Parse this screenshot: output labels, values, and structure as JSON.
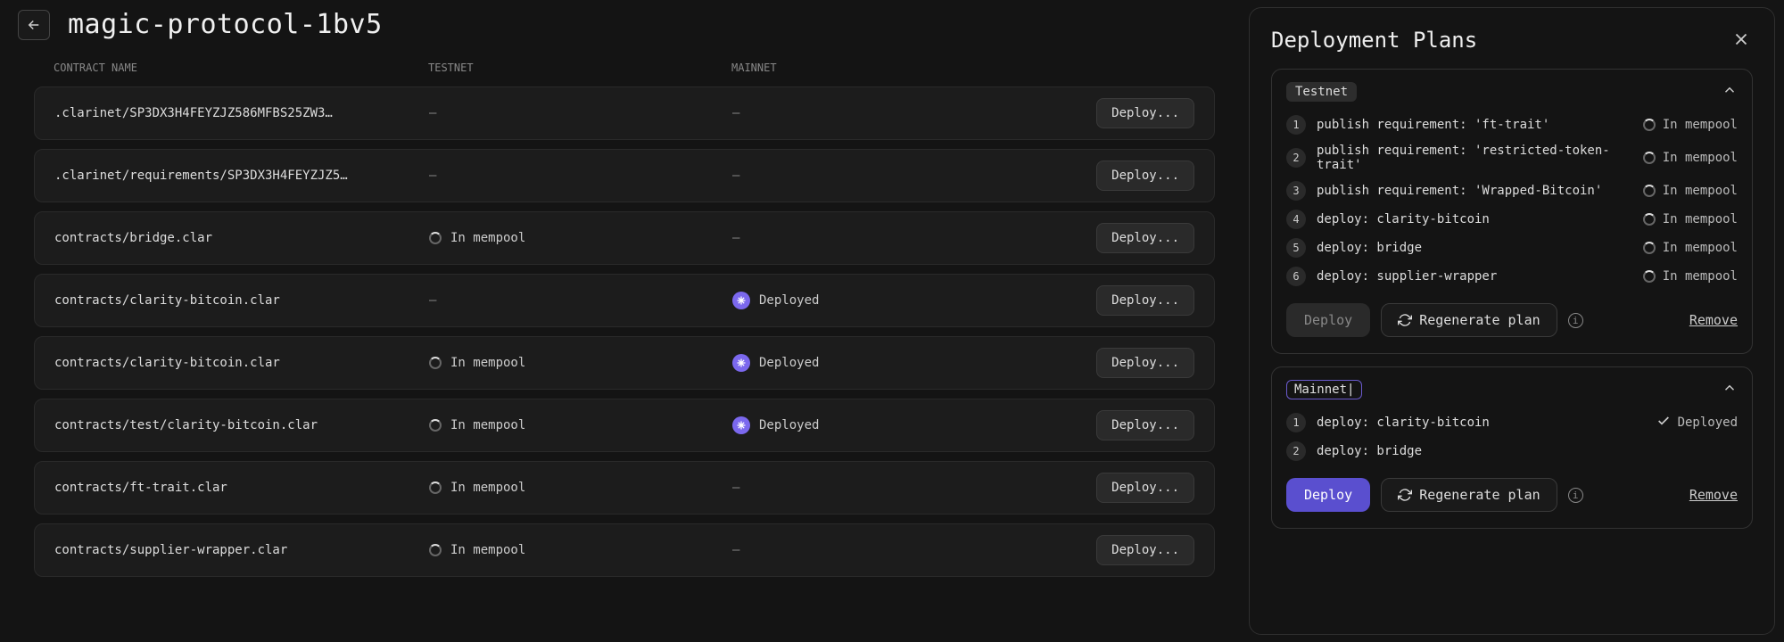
{
  "header": {
    "title": "magic-protocol-1bv5"
  },
  "table": {
    "columns": {
      "name": "CONTRACT NAME",
      "testnet": "TESTNET",
      "mainnet": "MAINNET"
    },
    "deploy_label": "Deploy...",
    "status": {
      "in_mempool": "In mempool",
      "deployed": "Deployed",
      "none": "–"
    },
    "rows": [
      {
        "name": ".clarinet/SP3DX3H4FEYZJZ586MFBS25ZW3…",
        "testnet": "none",
        "mainnet": "none"
      },
      {
        "name": ".clarinet/requirements/SP3DX3H4FEYZJZ5…",
        "testnet": "none",
        "mainnet": "none"
      },
      {
        "name": "contracts/bridge.clar",
        "testnet": "in_mempool",
        "mainnet": "none"
      },
      {
        "name": "contracts/clarity-bitcoin.clar",
        "testnet": "none",
        "mainnet": "deployed"
      },
      {
        "name": "contracts/clarity-bitcoin.clar",
        "testnet": "in_mempool",
        "mainnet": "deployed"
      },
      {
        "name": "contracts/test/clarity-bitcoin.clar",
        "testnet": "in_mempool",
        "mainnet": "deployed"
      },
      {
        "name": "contracts/ft-trait.clar",
        "testnet": "in_mempool",
        "mainnet": "none"
      },
      {
        "name": "contracts/supplier-wrapper.clar",
        "testnet": "in_mempool",
        "mainnet": "none"
      }
    ]
  },
  "panel": {
    "title": "Deployment Plans",
    "deploy_label": "Deploy",
    "regenerate_label": "Regenerate plan",
    "remove_label": "Remove",
    "status": {
      "in_mempool": "In mempool",
      "deployed": "Deployed"
    },
    "plans": [
      {
        "network": "Testnet",
        "deploy_enabled": false,
        "editing": false,
        "steps": [
          {
            "n": "1",
            "label": "publish requirement: 'ft-trait'",
            "status": "in_mempool"
          },
          {
            "n": "2",
            "label": "publish requirement: 'restricted-token-trait'",
            "status": "in_mempool"
          },
          {
            "n": "3",
            "label": "publish requirement: 'Wrapped-Bitcoin'",
            "status": "in_mempool"
          },
          {
            "n": "4",
            "label": "deploy: clarity-bitcoin",
            "status": "in_mempool"
          },
          {
            "n": "5",
            "label": "deploy: bridge",
            "status": "in_mempool"
          },
          {
            "n": "6",
            "label": "deploy: supplier-wrapper",
            "status": "in_mempool"
          }
        ]
      },
      {
        "network": "Mainnet",
        "deploy_enabled": true,
        "editing": true,
        "steps": [
          {
            "n": "1",
            "label": "deploy: clarity-bitcoin",
            "status": "deployed"
          },
          {
            "n": "2",
            "label": "deploy: bridge",
            "status": "none"
          }
        ]
      }
    ]
  }
}
